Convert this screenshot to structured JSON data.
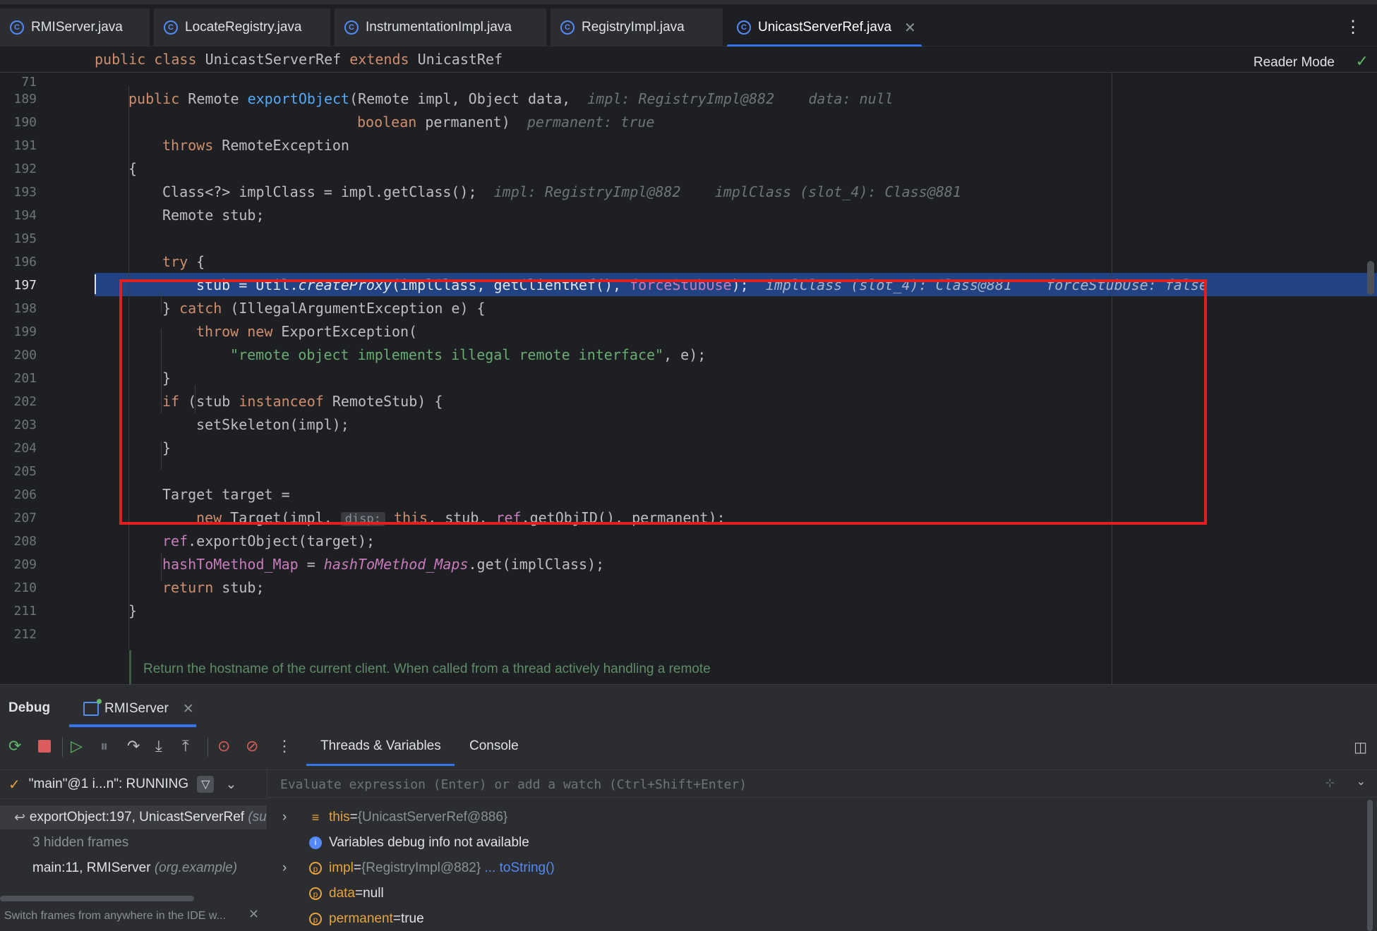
{
  "tabs": [
    {
      "label": "RMIServer.java"
    },
    {
      "label": "LocateRegistry.java"
    },
    {
      "label": "InstrumentationImpl.java"
    },
    {
      "label": "RegistryImpl.java"
    },
    {
      "label": "UnicastServerRef.java",
      "active": true
    }
  ],
  "editor": {
    "reader_mode": "Reader Mode",
    "sticky": {
      "line": "71",
      "kw1": "public",
      "kw2": "class",
      "name": "UnicastServerRef",
      "kw3": "extends",
      "parent": "UnicastRef"
    },
    "lines": [
      "189",
      "190",
      "191",
      "192",
      "193",
      "194",
      "195",
      "196",
      "197",
      "198",
      "199",
      "200",
      "201",
      "202",
      "203",
      "204",
      "205",
      "206",
      "207",
      "208",
      "209",
      "210",
      "211",
      "212"
    ],
    "current_line": "197",
    "hints": {
      "l189_impl": "impl: RegistryImpl@882",
      "l189_data": "data: null",
      "l190_perm": "permanent: true",
      "l193_impl": "impl: RegistryImpl@882",
      "l193_cls": "implClass (slot_4): Class@881",
      "l197_cls": "implClass (slot_4): Class@881",
      "l197_force": "forceStubUse: false",
      "l207_disp": "disp:"
    },
    "doc_comment": "Return the hostname of the current client. When called from a thread actively handling a remote"
  },
  "debug": {
    "title": "Debug",
    "run_config": "RMIServer",
    "subtabs": [
      "Threads & Variables",
      "Console"
    ],
    "thread": "\"main\"@1 i...n\": RUNNING",
    "frames": [
      {
        "method": "exportObject:197, UnicastServerRef",
        "pkg": "(su"
      },
      {
        "method": "3 hidden frames",
        "pkg": ""
      },
      {
        "method": "main:11, RMIServer",
        "pkg": "(org.example)"
      }
    ],
    "eval_placeholder": "Evaluate expression (Enter) or add a watch (Ctrl+Shift+Enter)",
    "variables": [
      {
        "name": "this",
        "eq": " = ",
        "value": "{UnicastServerRef@886}",
        "extra": ""
      },
      {
        "name": "Variables debug info not available",
        "eq": "",
        "value": "",
        "extra": ""
      },
      {
        "name": "impl",
        "eq": " = ",
        "value": "{RegistryImpl@882}",
        "extra": "... toString()"
      },
      {
        "name": "data",
        "eq": " = ",
        "value": "null",
        "extra": ""
      },
      {
        "name": "permanent",
        "eq": " = ",
        "value": "true",
        "extra": ""
      }
    ],
    "tip": "Switch frames from anywhere in the IDE w..."
  }
}
